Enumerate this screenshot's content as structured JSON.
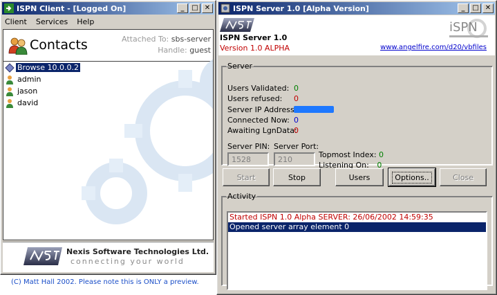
{
  "client": {
    "title": "ISPN Client - [Logged On]",
    "menu": [
      "Client",
      "Services",
      "Help"
    ],
    "panel_title": "Contacts",
    "attached_label": "Attached To:",
    "attached_value": "sbs-server",
    "handle_label": "Handle:",
    "handle_value": "guest",
    "contacts": [
      {
        "label": "Browse 10.0.0.2",
        "icon": "browse-icon",
        "selected": true
      },
      {
        "label": "admin",
        "icon": "user-icon",
        "selected": false
      },
      {
        "label": "jason",
        "icon": "user-icon",
        "selected": false
      },
      {
        "label": "david",
        "icon": "user-icon",
        "selected": false
      }
    ],
    "company_name": "Nexis Software Technologies Ltd.",
    "company_tagline": "connecting your world",
    "copyright": "(C) Matt Hall 2002. Please note this is ONLY a preview."
  },
  "server": {
    "title": "ISPN Server 1.0  [Alpha Version]",
    "app_name": "ISPN Server 1.0",
    "version": "Version 1.0 ALPHA",
    "link": "www.angelfire.com/d20/vbfiles",
    "group_label": "Server",
    "stats": {
      "validated_label": "Users Validated:",
      "validated_value": "0",
      "refused_label": "Users refused:",
      "refused_value": "0",
      "ip_label": "Server IP Address:",
      "connected_label": "Connected Now:",
      "connected_value": "0",
      "awaiting_label": "Awaiting LgnData:",
      "awaiting_value": "0"
    },
    "pin_label": "Server PIN:",
    "pin_value": "1528",
    "port_label": "Server Port:",
    "port_value": "210",
    "topmost_label": "Topmost Index:",
    "topmost_value": "0",
    "listening_label": "Listening On:",
    "listening_value": "0",
    "buttons": {
      "start": "Start",
      "stop": "Stop",
      "users": "Users",
      "options": "Options..",
      "close": "Close"
    },
    "activity_label": "Activity",
    "activity": [
      "Started ISPN 1.0 Alpha SERVER: 26/06/2002 14:59:35",
      "Opened server array element 0"
    ],
    "logo_text": "iSPN"
  },
  "colors": {
    "titlebar_start": "#0a246a",
    "titlebar_end": "#a6caf0",
    "error_red": "#c00000",
    "ok_green": "#008000",
    "info_blue": "#0000cc",
    "selection": "#0a246a"
  }
}
